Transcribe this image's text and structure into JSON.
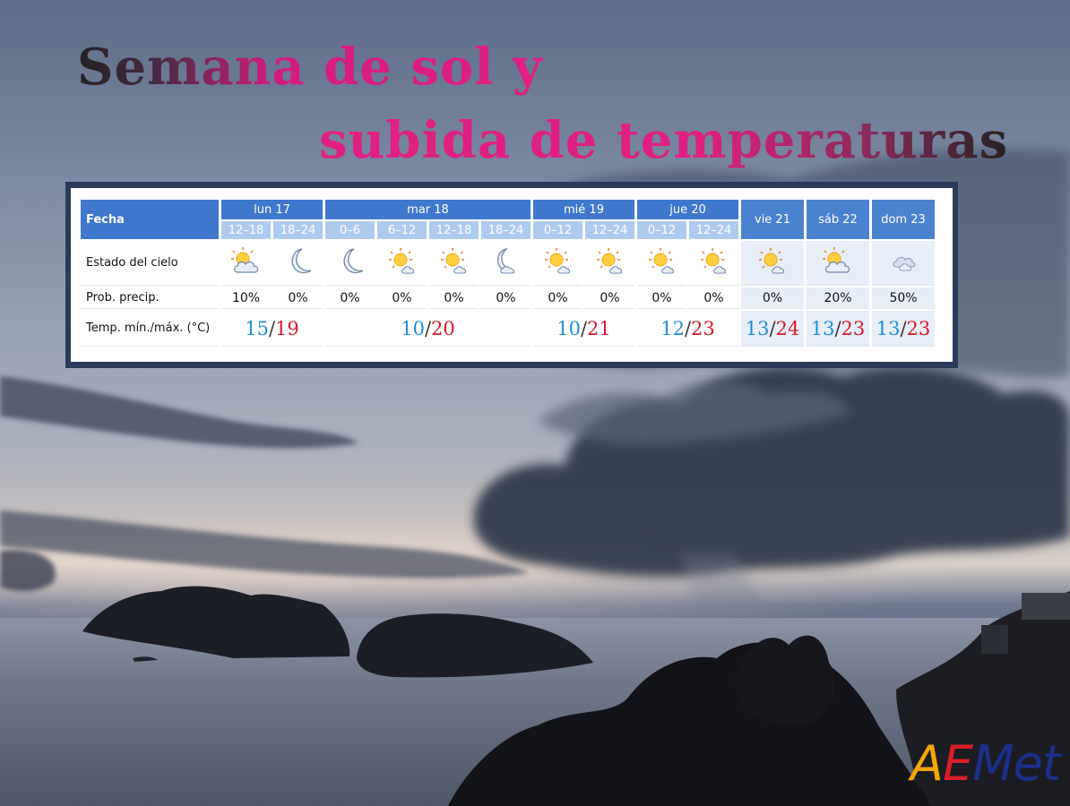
{
  "title": {
    "line1": "Semana de sol y",
    "line2": "subida de temperaturas"
  },
  "forecast": {
    "row_labels": {
      "fecha": "Fecha",
      "sky": "Estado del cielo",
      "prob": "Prob. precip.",
      "temp": "Temp. mín./máx. (°C)"
    },
    "days": [
      {
        "label": "lun 17",
        "periods": [
          "12–18",
          "18–24"
        ]
      },
      {
        "label": "mar 18",
        "periods": [
          "0–6",
          "6–12",
          "12–18",
          "18–24"
        ]
      },
      {
        "label": "mié 19",
        "periods": [
          "0–12",
          "12–24"
        ]
      },
      {
        "label": "jue 20",
        "periods": [
          "0–12",
          "12–24"
        ]
      },
      {
        "label": "vie 21",
        "periods": []
      },
      {
        "label": "sáb 22",
        "periods": []
      },
      {
        "label": "dom 23",
        "periods": []
      }
    ],
    "sky_icons": [
      "sun-behind-cloud-icon",
      "crescent-moon-icon",
      "crescent-moon-icon",
      "sun-small-cloud-icon",
      "sun-small-cloud-icon",
      "moon-cloud-icon",
      "sun-small-cloud-icon",
      "sun-small-cloud-icon",
      "sun-small-cloud-icon",
      "sun-small-cloud-icon",
      "sun-small-cloud-icon",
      "sun-behind-cloud-icon",
      "cloudy-icon"
    ],
    "precip": [
      "10%",
      "0%",
      "0%",
      "0%",
      "0%",
      "0%",
      "0%",
      "0%",
      "0%",
      "0%",
      "0%",
      "20%",
      "50%"
    ],
    "temps": [
      {
        "min": "15",
        "max": "19"
      },
      {
        "min": "10",
        "max": "20"
      },
      {
        "min": "10",
        "max": "21"
      },
      {
        "min": "12",
        "max": "23"
      },
      {
        "min": "13",
        "max": "24"
      },
      {
        "min": "13",
        "max": "23"
      },
      {
        "min": "13",
        "max": "23"
      }
    ],
    "temp_separator": "/",
    "colors": {
      "header": "#3f78cc",
      "subheader": "#aecbef",
      "min": "#1f8fd8",
      "max": "#d7182a"
    }
  },
  "logo": {
    "letters": [
      "A",
      "E",
      "M",
      "e",
      "t"
    ],
    "colors": [
      "#f3a700",
      "#d81e2a",
      "#1c2f8a",
      "#1c2f8a",
      "#1c2f8a"
    ]
  }
}
